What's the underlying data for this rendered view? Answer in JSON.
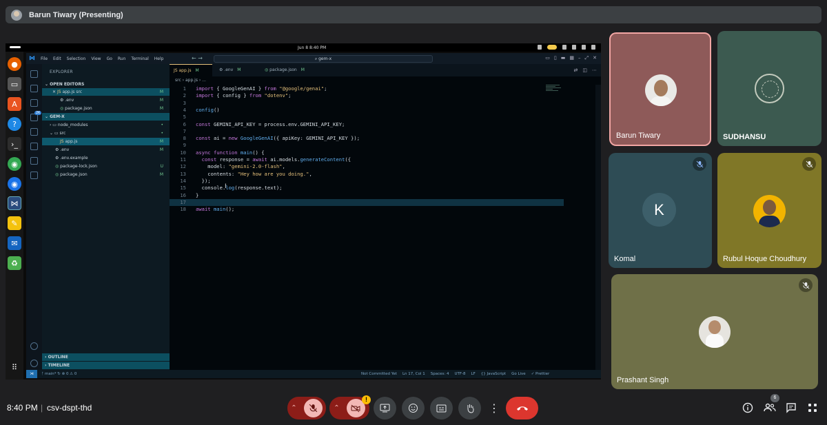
{
  "presenter": {
    "name": "Barun Tiwary (Presenting)"
  },
  "desktop": {
    "clock": "Jun 8   8:40 PM"
  },
  "vscode": {
    "menu": [
      "File",
      "Edit",
      "Selection",
      "View",
      "Go",
      "Run",
      "Terminal",
      "Help"
    ],
    "search": "gem-x",
    "explorer_title": "EXPLORER",
    "open_editors_title": "OPEN EDITORS",
    "open_editors": [
      {
        "name": "app.js src",
        "status": "M"
      },
      {
        "name": ".env",
        "status": "M"
      },
      {
        "name": "package.json",
        "status": "M"
      }
    ],
    "project_title": "GEM-X",
    "files": [
      {
        "name": "node_modules",
        "status": ""
      },
      {
        "name": "src",
        "status": ""
      },
      {
        "name": "app.js",
        "status": "M"
      },
      {
        "name": ".env",
        "status": "M"
      },
      {
        "name": ".env.example",
        "status": ""
      },
      {
        "name": "package-lock.json",
        "status": "U"
      },
      {
        "name": "package.json",
        "status": "M"
      }
    ],
    "outline_title": "OUTLINE",
    "timeline_title": "TIMELINE",
    "tabs": [
      {
        "name": "app.js",
        "status": "M"
      },
      {
        "name": ".env",
        "status": "M"
      },
      {
        "name": "package.json",
        "status": "M"
      }
    ],
    "breadcrumb": "src  ›  app.js  ›  ...",
    "code_lines": [
      "import { GoogleGenAI } from \"@google/genai\";",
      "import { config } from \"dotenv\";",
      "",
      "config()",
      "",
      "const GEMINI_API_KEY = process.env.GEMINI_API_KEY;",
      "",
      "const ai = new GoogleGenAI({ apiKey: GEMINI_API_KEY });",
      "",
      "async function main() {",
      "  const response = await ai.models.generateContent({",
      "    model: \"gemini-2.0-flash\",",
      "    contents: \"Hey how are you doing.\",",
      "  });",
      "  console.log(response.text);",
      "}",
      "",
      "await main();"
    ],
    "status_left": "ᚠ main*   ↻   ⊗ 0 ⚠ 0",
    "status_right": [
      "Not Committed Yet",
      "Ln 17, Col 1",
      "Spaces: 4",
      "UTF-8",
      "LF",
      "{} JavaScript",
      "Go Live",
      "✓ Prettier"
    ]
  },
  "participants": [
    {
      "name": "Barun Tiwary",
      "muted": false
    },
    {
      "name": "SUDHANSU",
      "muted": false
    },
    {
      "name": "Komal",
      "initial": "K",
      "muted": true
    },
    {
      "name": "Rubul Hoque Choudhury",
      "muted": true
    },
    {
      "name": "Prashant Singh",
      "muted": true
    }
  ],
  "meeting": {
    "time": "8:40 PM",
    "separator": "|",
    "code": "csv-dspt-thd",
    "people_count": "6"
  },
  "colors": {
    "hangup": "#dc362e",
    "muted_control": "#8c1d18",
    "warning": "#fbbc04"
  }
}
